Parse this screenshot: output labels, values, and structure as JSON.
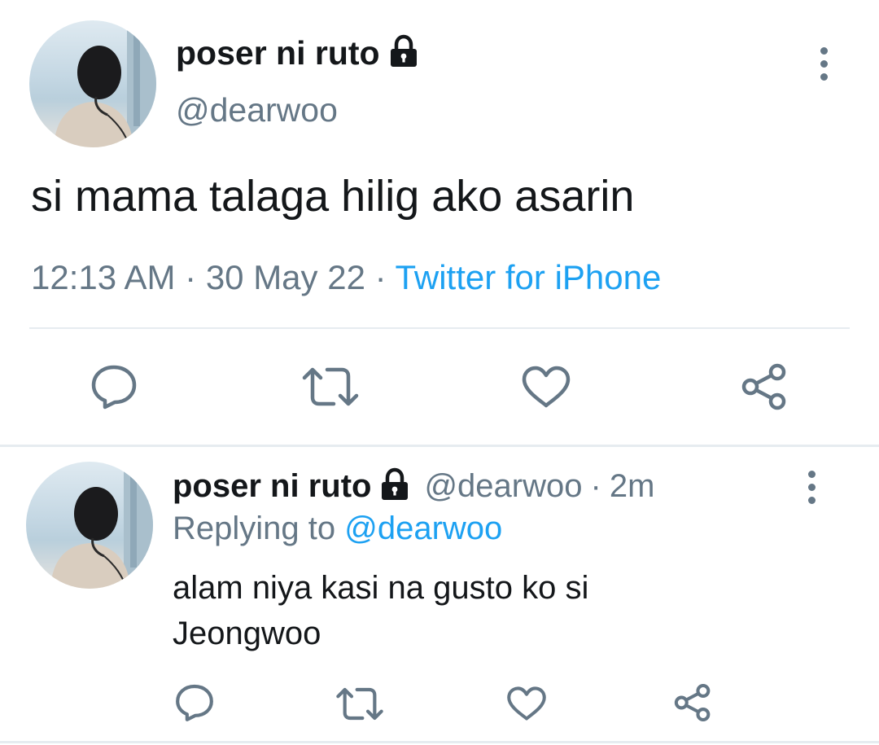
{
  "tweet": {
    "display_name": "poser ni ruto",
    "handle": "@dearwoo",
    "text": "si mama talaga hilig ako asarin",
    "time": "12:13 AM",
    "date": "30 May 22",
    "separator": "·",
    "source": "Twitter for iPhone",
    "lock_icon": "lock-icon",
    "more_icon": "more-vertical-icon",
    "actions": [
      "reply-icon",
      "retweet-icon",
      "like-icon",
      "share-icon"
    ]
  },
  "reply": {
    "display_name": "poser ni ruto",
    "handle": "@dearwoo",
    "separator": "·",
    "age": "2m",
    "replying_prefix": "Replying to",
    "replying_to": "@dearwoo",
    "text_line1": "alam niya kasi na gusto ko si",
    "text_line2": "Jeongwoo",
    "lock_icon": "lock-icon",
    "more_icon": "more-vertical-icon",
    "actions": [
      "reply-icon",
      "retweet-icon",
      "like-icon",
      "share-icon"
    ]
  },
  "colors": {
    "text": "#14171a",
    "secondary": "#657786",
    "accent": "#1da1f2",
    "divider": "#e6ecf0"
  }
}
